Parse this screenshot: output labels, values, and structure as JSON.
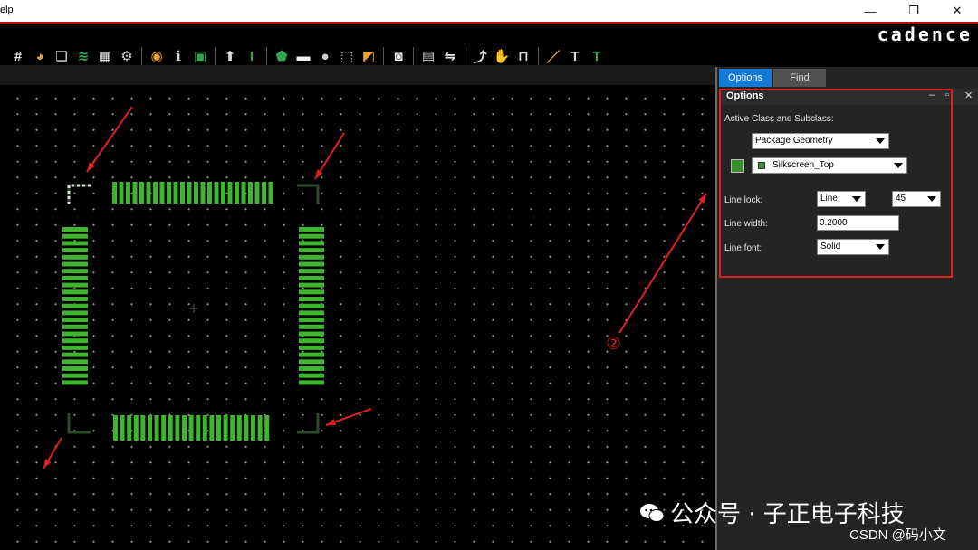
{
  "window": {
    "menu_fragment": "elp",
    "minimize_glyph": "—",
    "maximize_glyph": "❐",
    "close_glyph": "✕",
    "brand": "cadence",
    "brand_color": "#ffffff",
    "accent_red": "#c00000"
  },
  "toolbar": {
    "groups": [
      [
        "grid-icon",
        "color-icon",
        "shape-copy-icon",
        "layers-icon",
        "spreadsheet-icon",
        "gear-doc-icon"
      ],
      [
        "eye-icon",
        "info-icon",
        "package-icon"
      ],
      [
        "pin-icon",
        "text-cursor-icon"
      ],
      [
        "add-shape-icon",
        "add-rect-icon",
        "add-circle-icon",
        "select-region-icon",
        "fill-icon"
      ],
      [
        "camera-icon"
      ],
      [
        "report-icon",
        "swap-icon"
      ],
      [
        "route-icon",
        "hand-icon",
        "slide-icon"
      ],
      [
        "add-line-icon",
        "add-text-icon",
        "edit-text-icon"
      ]
    ]
  },
  "panel": {
    "tabs": [
      "Options",
      "Find"
    ],
    "active_tab": "Options",
    "title": "Options",
    "active_class_label": "Active Class and Subclass:",
    "class_value": "Package Geometry",
    "subclass_value": "Silkscreen_Top",
    "subclass_color": "#3b8e2f",
    "line_lock_label": "Line lock:",
    "line_lock_type": "Line",
    "line_lock_angle": "45",
    "line_width_label": "Line width:",
    "line_width_value": "0.2000",
    "line_font_label": "Line font:",
    "line_font_value": "Solid"
  },
  "annotations": {
    "callout_number": "②",
    "highlight_color": "#e02020"
  },
  "footer": {
    "watermark": "公众号 · 子正电子科技",
    "credit": "CSDN @码小文"
  },
  "board": {
    "pad_color": "#3db52f",
    "silk_color": "#2e4a2a",
    "top_pads": 24,
    "bottom_pads": 23,
    "left_pads": 23,
    "right_pads": 23
  }
}
